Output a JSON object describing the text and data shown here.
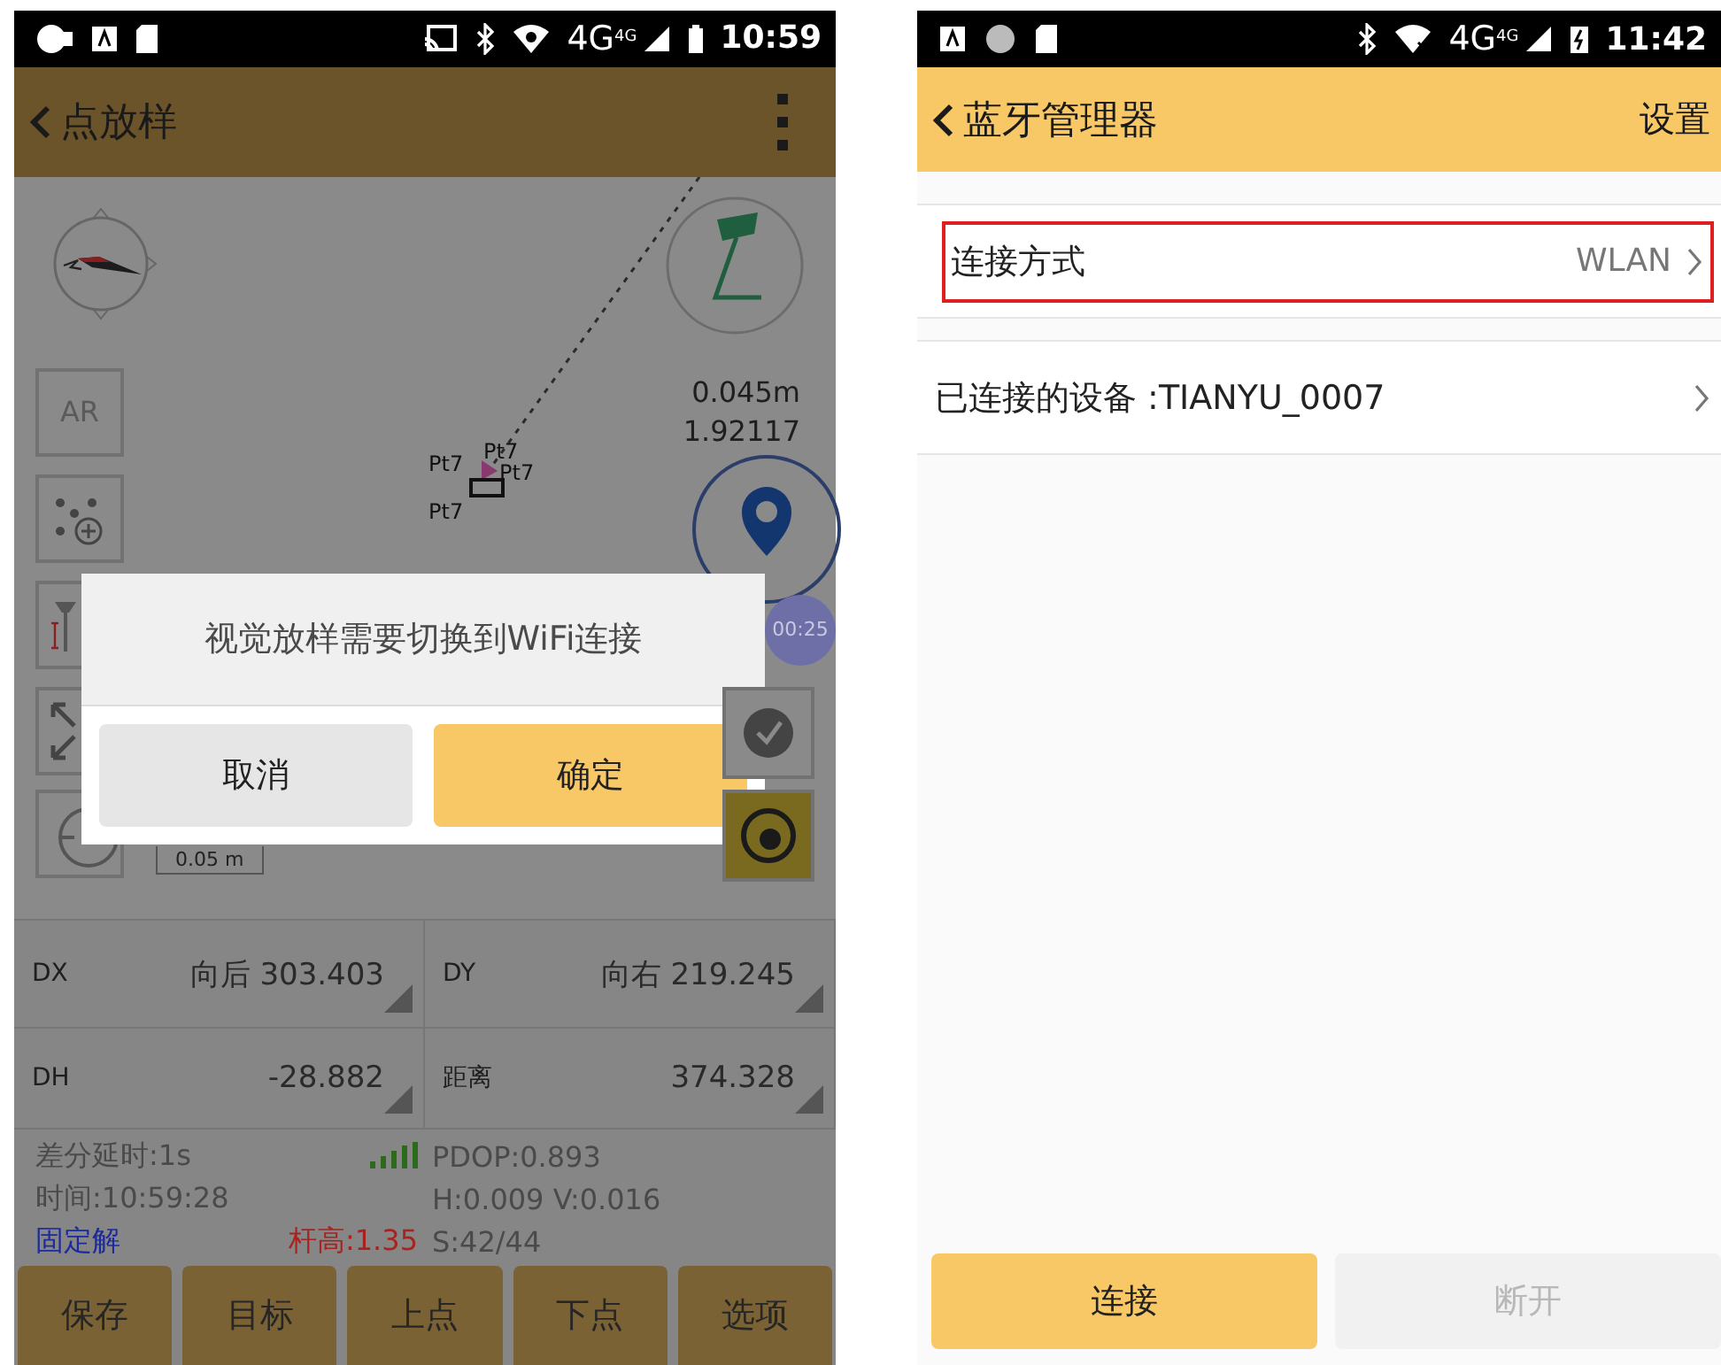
{
  "left_screen": {
    "status_bar": {
      "network": "4G",
      "network_badge": "4G",
      "time": "10:59"
    },
    "title": "点放样",
    "map": {
      "ar_button": "AR",
      "point_labels": [
        "Pt7",
        "Pt7",
        "Pt7",
        "Pt7"
      ],
      "offset": "0.045m",
      "bearing": "1.92117",
      "timer": "00:25",
      "scale": "0.05 m"
    },
    "dialog": {
      "message": "视觉放样需要切换到WiFi连接",
      "buttons": [
        {
          "label": "取消",
          "kind": "secondary"
        },
        {
          "label": "确定",
          "kind": "primary"
        }
      ]
    },
    "measurements": [
      {
        "label": "DX",
        "value": "向后 303.403"
      },
      {
        "label": "DY",
        "value": "向右 219.245"
      },
      {
        "label": "DH",
        "value": "-28.882"
      },
      {
        "label": "距离",
        "value": "374.328"
      }
    ],
    "info": [
      {
        "cells": [
          {
            "kind": "text",
            "text": "差分延时:1s",
            "color": "#4a4a4a"
          },
          {
            "kind": "signal"
          }
        ],
        "right": "PDOP:0.893"
      },
      {
        "cells": [
          {
            "kind": "text",
            "text": "时间:10:59:28",
            "color": "#4a4a4a"
          }
        ],
        "right": "H:0.009  V:0.016"
      },
      {
        "cells": [
          {
            "kind": "text",
            "text": "固定解",
            "color": "#1c2a9c"
          },
          {
            "kind": "text",
            "text": "杆高:1.35",
            "color": "#a8231f"
          }
        ],
        "right": "S:42/44"
      }
    ],
    "buttons": [
      "保存",
      "目标",
      "上点",
      "下点",
      "选项"
    ]
  },
  "right_screen": {
    "status_bar": {
      "network": "4G",
      "network_badge": "4G",
      "time": "11:42"
    },
    "title": "蓝牙管理器",
    "action": "设置",
    "rows": [
      {
        "label": "连接方式",
        "value": "WLAN",
        "highlighted": true
      },
      {
        "label": "已连接的设备 :TIANYU_0007",
        "highlighted": false
      }
    ],
    "buttons": [
      {
        "label": "连接",
        "disabled": false
      },
      {
        "label": "断开",
        "disabled": true
      }
    ]
  }
}
